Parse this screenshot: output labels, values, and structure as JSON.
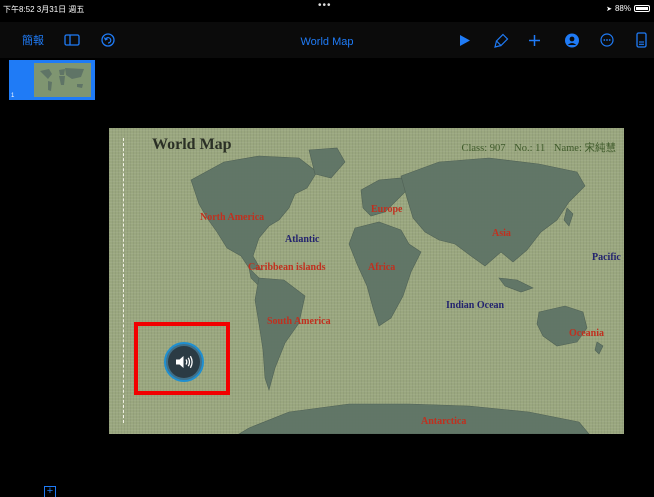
{
  "status_bar": {
    "time": "下午8:52  3月31日 週五",
    "dots": "•••",
    "battery_text": "88%"
  },
  "toolbar": {
    "simplified_label": "簡報",
    "document_title": "World Map"
  },
  "sidebar": {
    "slides": [
      {
        "number": "1",
        "selected": true
      }
    ]
  },
  "slide": {
    "title": "World Map",
    "meta": {
      "class": "Class: 907",
      "number": "No.: 11",
      "name": "Name: 宋純慧"
    },
    "labels": {
      "north_america": "North America",
      "europe": "Europe",
      "atlantic": "Atlantic",
      "asia": "Asia",
      "caribbean": "Caribbean islands",
      "africa": "Africa",
      "pacific": "Pacific",
      "indian_ocean": "Indian Ocean",
      "south_america": "South America",
      "oceania": "Oceania",
      "antarctica": "Antarctica"
    }
  },
  "colors": {
    "accent": "#1f7bf6",
    "highlight": "#f20000",
    "slide_bg": "#9aa77f",
    "continent_label": "#c0301f",
    "ocean_label": "#23236e"
  },
  "icons": [
    "battery-icon",
    "sidebar-toggle-icon",
    "undo-icon",
    "play-icon",
    "format-brush-icon",
    "add-icon",
    "collaborate-icon",
    "more-icon",
    "document-icon",
    "speaker-icon",
    "add-slide-icon"
  ]
}
